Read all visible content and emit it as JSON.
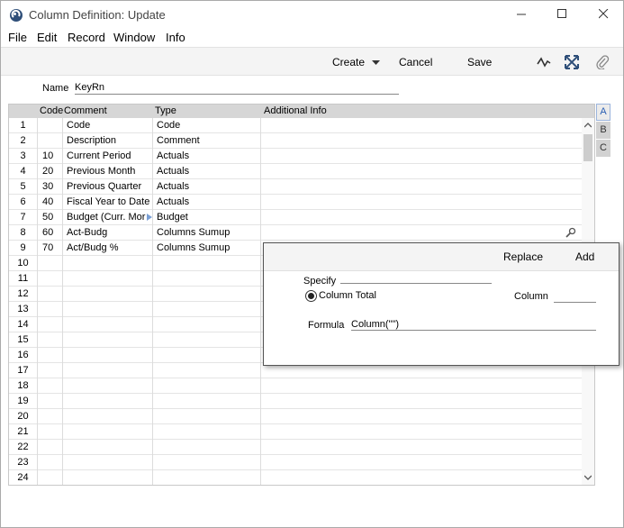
{
  "window": {
    "title": "Column Definition: Update"
  },
  "menu": [
    "File",
    "Edit",
    "Record",
    "Window",
    "Info"
  ],
  "toolbar": {
    "create": "Create",
    "cancel": "Cancel",
    "save": "Save"
  },
  "form": {
    "name_label": "Name",
    "name_value": "KeyRn"
  },
  "grid": {
    "headers": {
      "code": "Code",
      "comment": "Comment",
      "type": "Type",
      "additional": "Additional Info"
    },
    "rows": [
      {
        "num": "1",
        "code": "",
        "comment": "Code",
        "type": "Code",
        "additional": ""
      },
      {
        "num": "2",
        "code": "",
        "comment": "Description",
        "type": "Comment",
        "additional": ""
      },
      {
        "num": "3",
        "code": "10",
        "comment": "Current Period",
        "type": "Actuals",
        "additional": ""
      },
      {
        "num": "4",
        "code": "20",
        "comment": "Previous Month",
        "type": "Actuals",
        "additional": ""
      },
      {
        "num": "5",
        "code": "30",
        "comment": "Previous Quarter",
        "type": "Actuals",
        "additional": ""
      },
      {
        "num": "6",
        "code": "40",
        "comment": "Fiscal Year to Date",
        "type": "Actuals",
        "additional": ""
      },
      {
        "num": "7",
        "code": "50",
        "comment": "Budget (Curr. Mor",
        "type": "Budget",
        "additional": ""
      },
      {
        "num": "8",
        "code": "60",
        "comment": "Act-Budg",
        "type": "Columns Sumup",
        "additional": ""
      },
      {
        "num": "9",
        "code": "70",
        "comment": "Act/Budg %",
        "type": "Columns Sumup",
        "additional": ""
      },
      {
        "num": "10",
        "code": "",
        "comment": "",
        "type": "",
        "additional": ""
      },
      {
        "num": "11",
        "code": "",
        "comment": "",
        "type": "",
        "additional": ""
      },
      {
        "num": "12",
        "code": "",
        "comment": "",
        "type": "",
        "additional": ""
      },
      {
        "num": "13",
        "code": "",
        "comment": "",
        "type": "",
        "additional": ""
      },
      {
        "num": "14",
        "code": "",
        "comment": "",
        "type": "",
        "additional": ""
      },
      {
        "num": "15",
        "code": "",
        "comment": "",
        "type": "",
        "additional": ""
      },
      {
        "num": "16",
        "code": "",
        "comment": "",
        "type": "",
        "additional": ""
      },
      {
        "num": "17",
        "code": "",
        "comment": "",
        "type": "",
        "additional": ""
      },
      {
        "num": "18",
        "code": "",
        "comment": "",
        "type": "",
        "additional": ""
      },
      {
        "num": "19",
        "code": "",
        "comment": "",
        "type": "",
        "additional": ""
      },
      {
        "num": "20",
        "code": "",
        "comment": "",
        "type": "",
        "additional": ""
      },
      {
        "num": "21",
        "code": "",
        "comment": "",
        "type": "",
        "additional": ""
      },
      {
        "num": "22",
        "code": "",
        "comment": "",
        "type": "",
        "additional": ""
      },
      {
        "num": "23",
        "code": "",
        "comment": "",
        "type": "",
        "additional": ""
      },
      {
        "num": "24",
        "code": "",
        "comment": "",
        "type": "",
        "additional": ""
      }
    ]
  },
  "side_tabs": [
    "A",
    "B",
    "C"
  ],
  "popup": {
    "replace": "Replace",
    "add": "Add",
    "specify_label": "Specify",
    "specify_value": "",
    "radio_label": "Column Total",
    "column_label": "Column",
    "column_value": "",
    "formula_label": "Formula",
    "formula_value": "Column(\"\")"
  },
  "colors": {
    "accent": "#2b5fb4",
    "header_bg": "#d6d6d6",
    "toolbar_bg": "#f4f4f4"
  },
  "icons": [
    "app-logo-icon",
    "minimize-icon",
    "maximize-icon",
    "close-icon",
    "dropdown-arrow-icon",
    "activity-icon",
    "expand-icon",
    "paperclip-icon",
    "paste-special-icon",
    "row-arrow-icon",
    "scroll-up-icon",
    "scroll-down-icon"
  ]
}
